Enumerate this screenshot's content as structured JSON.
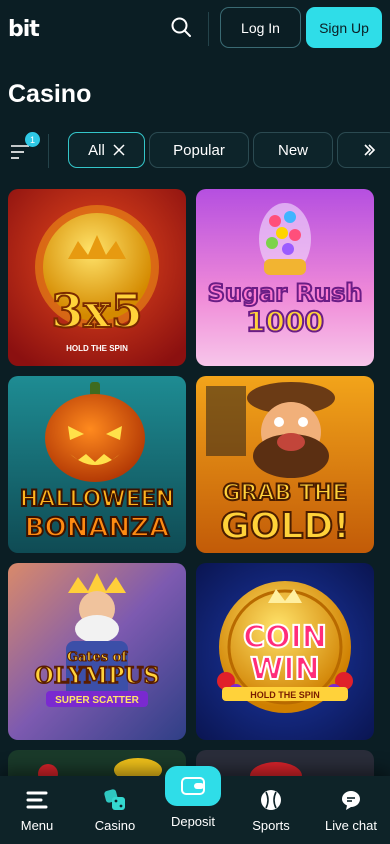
{
  "header": {
    "logo_text": "bit",
    "login_label": "Log In",
    "signup_label": "Sign Up"
  },
  "page_title": "Casino",
  "filters": {
    "badge_count": "1",
    "chips": [
      "All",
      "Popular",
      "New"
    ]
  },
  "games": [
    {
      "title_line1": "3x5",
      "subtitle": "HOLD THE SPIN"
    },
    {
      "title_line1": "Sugar Rush",
      "title_line2": "1000"
    },
    {
      "title_line1": "HALLOWEEN",
      "title_line2": "BONANZA"
    },
    {
      "title_line1": "GRAB THE",
      "title_line2": "GOLD!"
    },
    {
      "title_line1": "Gates of",
      "title_line2": "OLYMPUS",
      "subtitle": "SUPER SCATTER"
    },
    {
      "title_line1": "COIN",
      "title_line2": "WIN",
      "subtitle": "HOLD THE SPIN"
    }
  ],
  "bottom_nav": {
    "menu": "Menu",
    "casino": "Casino",
    "deposit": "Deposit",
    "sports": "Sports",
    "live_chat": "Live chat"
  },
  "colors": {
    "background": "#0b1e24",
    "accent": "#2fdde8",
    "chip_active_border": "#34c6c9"
  }
}
